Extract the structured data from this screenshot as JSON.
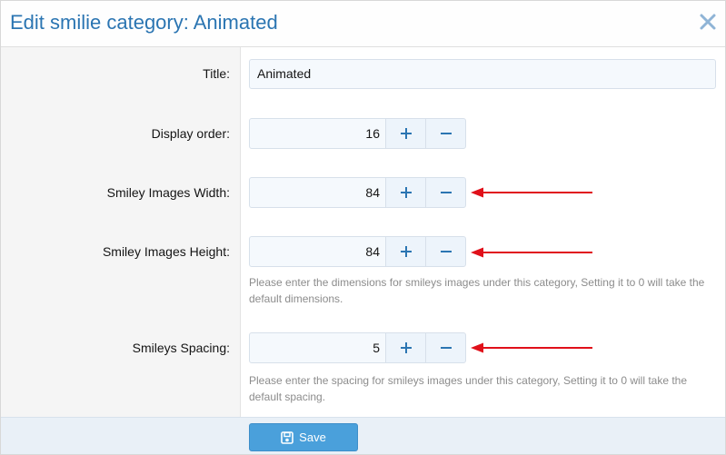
{
  "dialog": {
    "title": "Edit smilie category: Animated",
    "accent_color": "#2b75b2"
  },
  "form": {
    "title": {
      "label": "Title:",
      "value": "Animated"
    },
    "display_order": {
      "label": "Display order:",
      "value": "16"
    },
    "width": {
      "label": "Smiley Images Width:",
      "value": "84"
    },
    "height": {
      "label": "Smiley Images Height:",
      "value": "84",
      "hint": "Please enter the dimensions for smileys images under this category, Setting it to 0 will take the default dimensions."
    },
    "spacing": {
      "label": "Smileys Spacing:",
      "value": "5",
      "hint": "Please enter the spacing for smileys images under this category, Setting it to 0 will take the default spacing."
    }
  },
  "footer": {
    "save_label": "Save"
  },
  "icons": {
    "close": "close-icon",
    "plus": "plus-icon",
    "minus": "minus-icon",
    "save": "save-icon",
    "annotation_arrow": "red-arrow-icon"
  },
  "colors": {
    "annotation": "#e0101a",
    "save_button": "#4aa0db"
  }
}
